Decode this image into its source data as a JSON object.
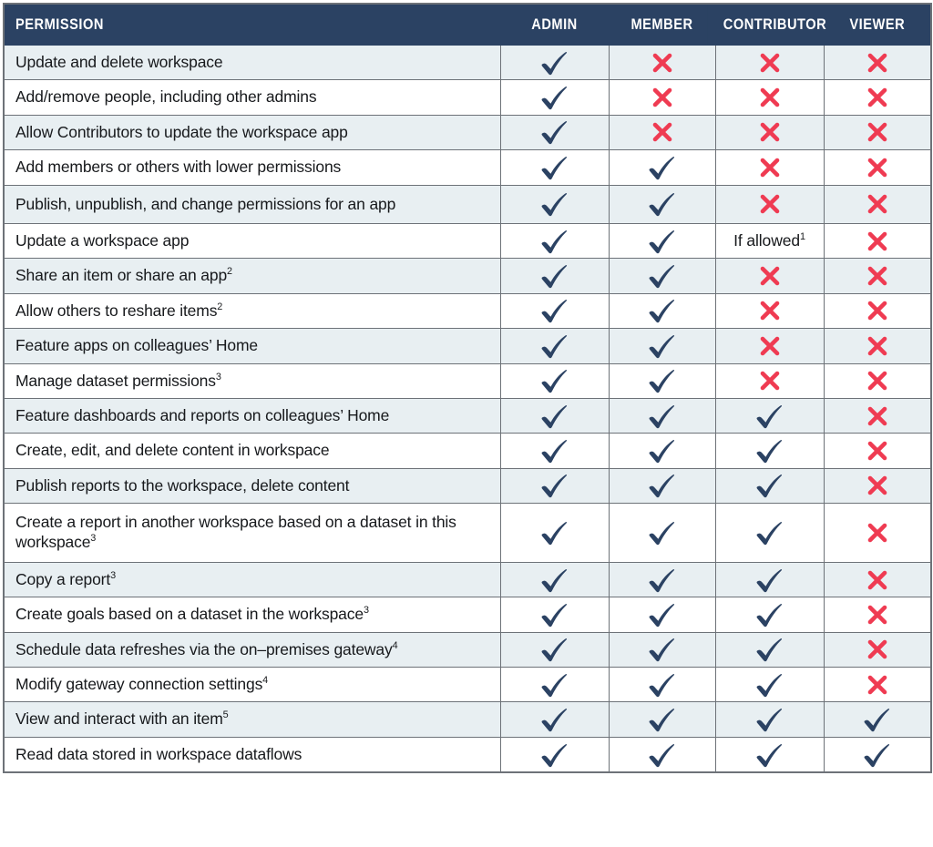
{
  "table": {
    "columns": [
      {
        "key": "permission",
        "label": "PERMISSION"
      },
      {
        "key": "admin",
        "label": "ADMIN"
      },
      {
        "key": "member",
        "label": "MEMBER"
      },
      {
        "key": "contributor",
        "label": "CONTRIBUTOR"
      },
      {
        "key": "viewer",
        "label": "VIEWER"
      }
    ],
    "marks": {
      "check": "check-mark",
      "cross": "cross-mark"
    },
    "colors": {
      "header_background": "#2b4263",
      "header_text": "#ffffff",
      "row_odd_background": "#e8eff2",
      "row_even_background": "#ffffff",
      "border": "#6d7278",
      "check": "#2b4263",
      "cross": "#ef3b52",
      "body_text": "#17191c"
    },
    "rows": [
      {
        "permission": "Update and delete workspace",
        "permission_sup": "",
        "admin": "check",
        "member": "cross",
        "contributor": "cross",
        "viewer": "cross"
      },
      {
        "permission": "Add/remove people, including other admins",
        "permission_sup": "",
        "admin": "check",
        "member": "cross",
        "contributor": "cross",
        "viewer": "cross"
      },
      {
        "permission": "Allow Contributors to update the workspace app",
        "permission_sup": "",
        "admin": "check",
        "member": "cross",
        "contributor": "cross",
        "viewer": "cross"
      },
      {
        "permission": "Add members or others with lower permissions",
        "permission_sup": "",
        "admin": "check",
        "member": "check",
        "contributor": "cross",
        "viewer": "cross"
      },
      {
        "permission": "Publish, unpublish, and change permissions for an app",
        "permission_sup": "",
        "admin": "check",
        "member": "check",
        "contributor": "cross",
        "viewer": "cross"
      },
      {
        "permission": "Update a workspace app",
        "permission_sup": "",
        "admin": "check",
        "member": "check",
        "contributor": "If allowed",
        "contributor_sup": "1",
        "viewer": "cross"
      },
      {
        "permission": "Share an item or share an app",
        "permission_sup": "2",
        "admin": "check",
        "member": "check",
        "contributor": "cross",
        "viewer": "cross"
      },
      {
        "permission": "Allow others to reshare items",
        "permission_sup": "2",
        "admin": "check",
        "member": "check",
        "contributor": "cross",
        "viewer": "cross"
      },
      {
        "permission": "Feature apps on colleagues’ Home",
        "permission_sup": "",
        "admin": "check",
        "member": "check",
        "contributor": "cross",
        "viewer": "cross"
      },
      {
        "permission": "Manage dataset permissions",
        "permission_sup": "3",
        "admin": "check",
        "member": "check",
        "contributor": "cross",
        "viewer": "cross"
      },
      {
        "permission": "Feature dashboards and reports on colleagues’ Home",
        "permission_sup": "",
        "admin": "check",
        "member": "check",
        "contributor": "check",
        "viewer": "cross"
      },
      {
        "permission": "Create, edit, and delete content in workspace",
        "permission_sup": "",
        "admin": "check",
        "member": "check",
        "contributor": "check",
        "viewer": "cross"
      },
      {
        "permission": "Publish reports to the workspace, delete content",
        "permission_sup": "",
        "admin": "check",
        "member": "check",
        "contributor": "check",
        "viewer": "cross"
      },
      {
        "permission": "Create a report in another workspace based on a dataset in this workspace",
        "permission_sup": "3",
        "admin": "check",
        "member": "check",
        "contributor": "check",
        "viewer": "cross"
      },
      {
        "permission": "Copy a report",
        "permission_sup": "3",
        "admin": "check",
        "member": "check",
        "contributor": "check",
        "viewer": "cross"
      },
      {
        "permission": "Create goals based on a dataset in the workspace",
        "permission_sup": "3",
        "admin": "check",
        "member": "check",
        "contributor": "check",
        "viewer": "cross"
      },
      {
        "permission": "Schedule data refreshes via the on–premises gateway",
        "permission_sup": "4",
        "admin": "check",
        "member": "check",
        "contributor": "check",
        "viewer": "cross"
      },
      {
        "permission": "Modify gateway connection settings",
        "permission_sup": "4",
        "admin": "check",
        "member": "check",
        "contributor": "check",
        "viewer": "cross"
      },
      {
        "permission": "View and interact with an item",
        "permission_sup": "5",
        "admin": "check",
        "member": "check",
        "contributor": "check",
        "viewer": "check"
      },
      {
        "permission": "Read data stored in workspace dataflows",
        "permission_sup": "",
        "admin": "check",
        "member": "check",
        "contributor": "check",
        "viewer": "check"
      }
    ]
  }
}
